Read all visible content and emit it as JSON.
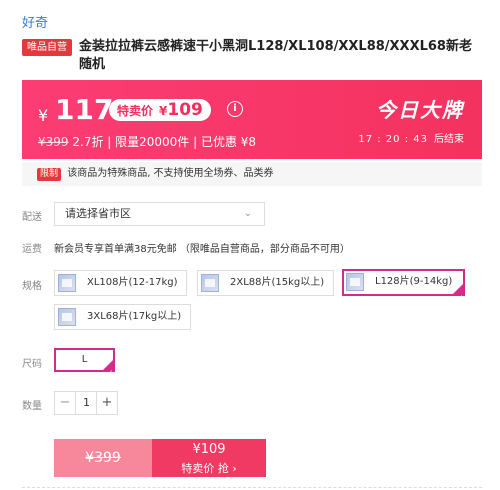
{
  "brand": "好奇",
  "product": {
    "badge": "唯品自营",
    "title": "金装拉拉裤云感裤速干小黑洞L128/XL108/XXL88/XXXL68新老随机"
  },
  "price_banner": {
    "currency": "¥",
    "price": "117",
    "tag_label": "特卖价",
    "tag_currency": "¥",
    "tag_price": "109",
    "info_icon": "info-icon",
    "original_price": "¥399",
    "subtext": "2.7折 | 限量20000件 | 已优惠 ¥8",
    "right_title": "今日大牌",
    "countdown": "17 : 20 : 43",
    "countdown_suffix": "后结束",
    "bg_color": "#f4325f"
  },
  "notice": {
    "tag": "限制",
    "text": "该商品为特殊商品, 不支持使用全场券、品类券"
  },
  "delivery": {
    "label": "配送",
    "placeholder": "请选择省市区",
    "chevron_icon": "chevron-down-icon"
  },
  "shipping": {
    "label": "运费",
    "text": "新会员专享首单满38元免邮 （限唯品自营商品，部分商品不可用）"
  },
  "spec": {
    "label": "规格",
    "options": [
      {
        "label": "XL108片(12-17kg)",
        "selected": false
      },
      {
        "label": "2XL88片(15kg以上)",
        "selected": false
      },
      {
        "label": "L128片(9-14kg)",
        "selected": true
      },
      {
        "label": "3XL68片(17kg以上)",
        "selected": false
      }
    ]
  },
  "size": {
    "label": "尺码",
    "value": "L"
  },
  "quantity": {
    "label": "数量",
    "minus": "−",
    "value": "1",
    "plus": "+"
  },
  "buy": {
    "original_price": "¥399",
    "price": "¥109",
    "label": "特卖价 抢 ›",
    "accent": "#f03a63"
  }
}
